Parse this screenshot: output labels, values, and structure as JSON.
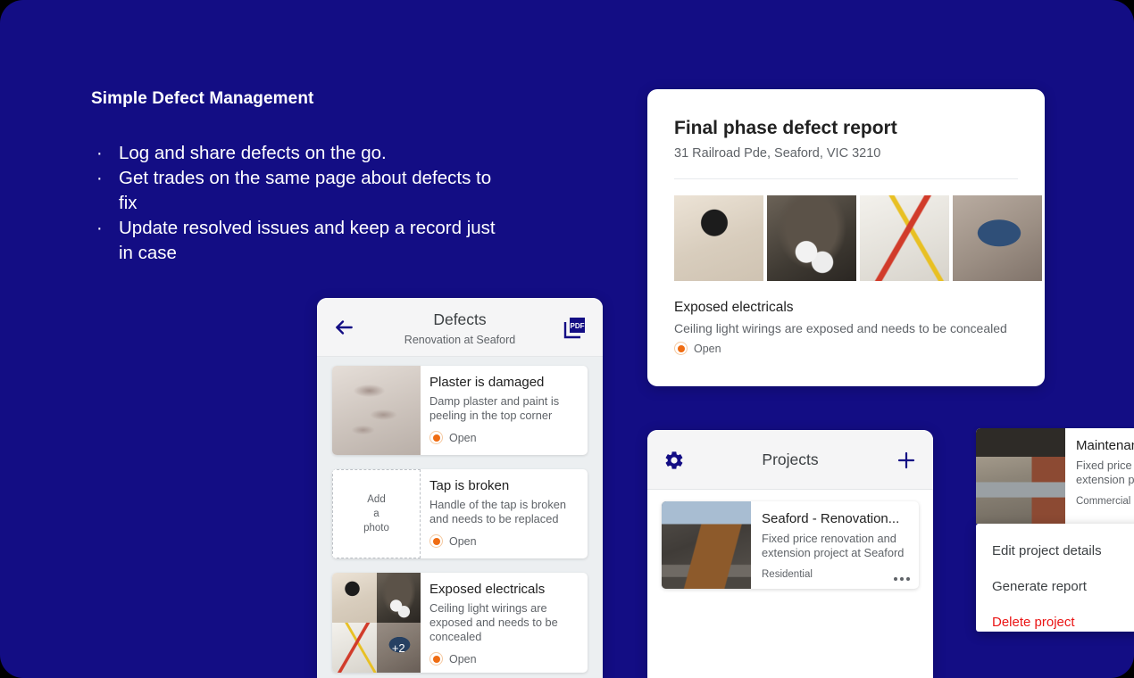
{
  "theme": {
    "background": "#130d84",
    "accent_navy": "#130d84",
    "status_orange": "#ef6c12",
    "danger_red": "#ea1414"
  },
  "promo": {
    "heading": "Simple Defect Management",
    "bullet_glyph": "·",
    "bullets": [
      "Log and share defects on the go.",
      "Get trades on the same page about defects to fix",
      "Update resolved issues and keep a record just in case"
    ]
  },
  "report_card": {
    "title": "Final phase defect report",
    "address": "31 Railroad Pde, Seaford, VIC 3210",
    "thumbnails": [
      "electrical-junction-box-photo",
      "ceiling-light-bulbs-photo",
      "loose-wiring-connectors-photo",
      "ceiling-hole-wiring-photo"
    ],
    "defect_title": "Exposed electricals",
    "defect_description": "Ceiling light wirings are exposed and needs to be concealed",
    "status": "Open"
  },
  "defects_panel": {
    "back_icon": "arrow-left-icon",
    "title": "Defects",
    "subtitle": "Renovation at Seaford",
    "pdf_icon": "pdf-export-icon",
    "pdf_label": "PDF",
    "items": [
      {
        "title": "Plaster is damaged",
        "description": "Damp plaster and paint is peeling in the top corner",
        "status": "Open",
        "thumb_type": "photo",
        "photo": "damaged-plaster-photo"
      },
      {
        "title": "Tap is broken",
        "description": "Handle of the tap is broken and needs to be replaced",
        "status": "Open",
        "thumb_type": "placeholder",
        "placeholder_lines": [
          "Add",
          "a",
          "photo"
        ]
      },
      {
        "title": "Exposed electricals",
        "description": "Ceiling light wirings are exposed and needs to be concealed",
        "status": "Open",
        "thumb_type": "grid",
        "photos": [
          "electrical-junction-box-photo",
          "ceiling-light-bulbs-photo",
          "loose-wiring-connectors-photo",
          "ceiling-hole-wiring-photo"
        ],
        "more_count": "+2"
      }
    ]
  },
  "projects_panel": {
    "settings_icon": "gear-icon",
    "title": "Projects",
    "add_icon": "plus-icon",
    "items": [
      {
        "title": "Seaford - Renovation...",
        "description": "Fixed price renovation and extension project at Seaford",
        "tag": "Residential",
        "menu_icon": "more-options-icon",
        "photo": "seaford-house-photo"
      }
    ]
  },
  "edge_project": {
    "title": "Maintenan...",
    "description": "Fixed price re... extension pro...",
    "description_line1": "Fixed price re",
    "description_line2": "extension pro",
    "tag": "Commercial",
    "photo": "train-station-platform-photo"
  },
  "context_menu": {
    "items": [
      {
        "label": "Edit project details",
        "style": "normal"
      },
      {
        "label": "Generate report",
        "style": "normal"
      },
      {
        "label": "Delete project",
        "style": "danger"
      }
    ]
  }
}
